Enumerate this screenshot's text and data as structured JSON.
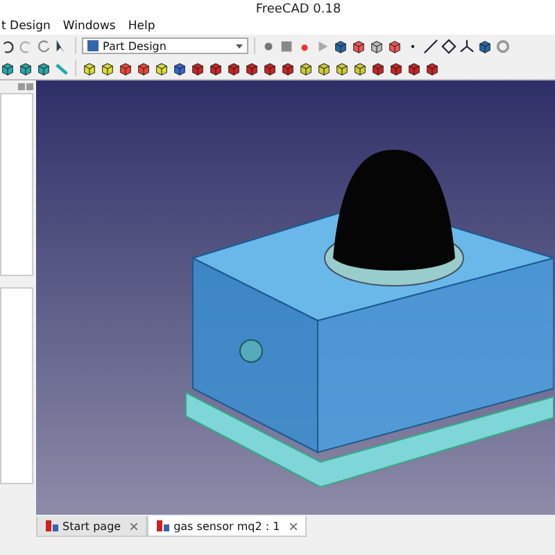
{
  "window": {
    "title": "FreeCAD 0.18"
  },
  "menu": [
    "t Design",
    "Windows",
    "Help"
  ],
  "workbench": {
    "value": "Part Design"
  },
  "tabs": [
    {
      "label": "Start page",
      "selected": false
    },
    {
      "label": "gas sensor mq2 : 1",
      "selected": true
    }
  ]
}
